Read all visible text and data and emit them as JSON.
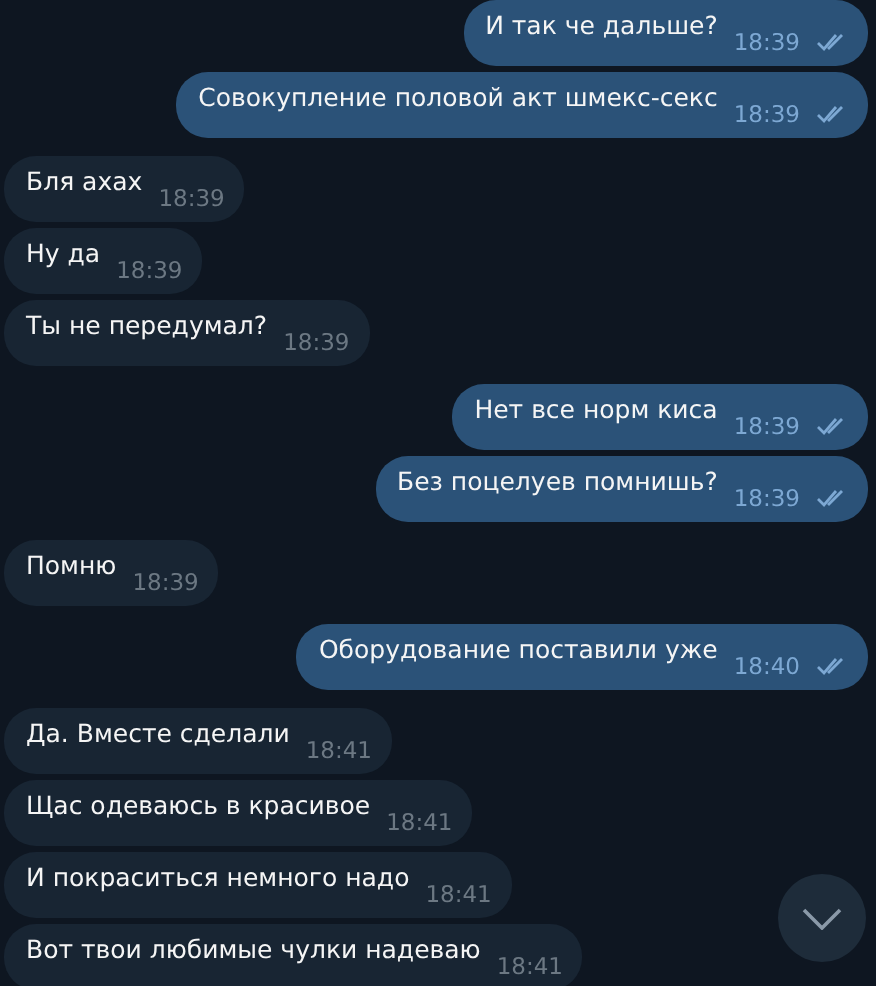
{
  "messages": [
    {
      "kind": "outgoing",
      "text": "И так че дальше?",
      "time": "18:39",
      "read": true
    },
    {
      "kind": "outgoing",
      "text": "Совокупление половой акт шмекс-секс",
      "time": "18:39",
      "read": true
    },
    {
      "kind": "incoming",
      "text": "Бля ахах",
      "time": "18:39"
    },
    {
      "kind": "incoming",
      "text": "Ну да",
      "time": "18:39"
    },
    {
      "kind": "incoming",
      "text": "Ты не передумал?",
      "time": "18:39"
    },
    {
      "kind": "outgoing",
      "text": "Нет все норм киса",
      "time": "18:39",
      "read": true
    },
    {
      "kind": "outgoing",
      "text": "Без поцелуев помнишь?",
      "time": "18:39",
      "read": true
    },
    {
      "kind": "incoming",
      "text": "Помню",
      "time": "18:39"
    },
    {
      "kind": "outgoing",
      "text": "Оборудование поставили уже",
      "time": "18:40",
      "read": true
    },
    {
      "kind": "incoming",
      "text": "Да. Вместе сделали",
      "time": "18:41"
    },
    {
      "kind": "incoming",
      "text": "Щас одеваюсь в красивое",
      "time": "18:41"
    },
    {
      "kind": "incoming",
      "text": "И покраситься немного надо",
      "time": "18:41"
    },
    {
      "kind": "incoming",
      "text": "Вот твои любимые чулки надеваю",
      "time": "18:41"
    }
  ]
}
